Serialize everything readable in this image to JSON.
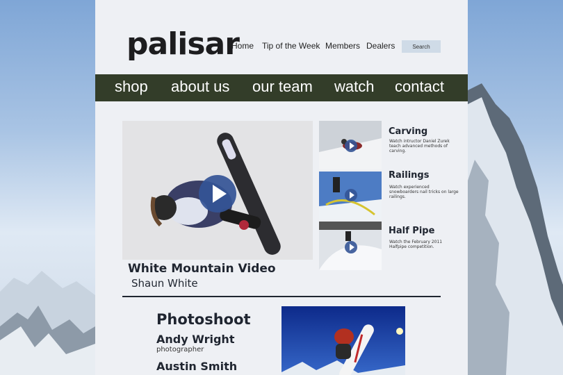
{
  "logo": "palisar",
  "topnav": [
    "Home",
    "Tip of the Week",
    "Members",
    "Dealers"
  ],
  "search": {
    "label": "Search"
  },
  "mainnav": [
    "shop",
    "about us",
    "our team",
    "watch",
    "contact"
  ],
  "featured": {
    "title": "White Mountain Video",
    "subtitle": "Shaun White"
  },
  "videos": [
    {
      "title": "Carving",
      "desc": "Watch intructor Daniel Zurek teach advanced methods of carving."
    },
    {
      "title": "Railings",
      "desc": "Watch experienced snowboarders nail tricks on large railings."
    },
    {
      "title": "Half Pipe",
      "desc": "Watch the February 2011 Halfpipe competition."
    }
  ],
  "photoshoot": {
    "title": "Photoshoot",
    "people": [
      {
        "name": "Andy Wright",
        "role": "photographer"
      },
      {
        "name": "Austin Smith",
        "role": ""
      }
    ]
  }
}
